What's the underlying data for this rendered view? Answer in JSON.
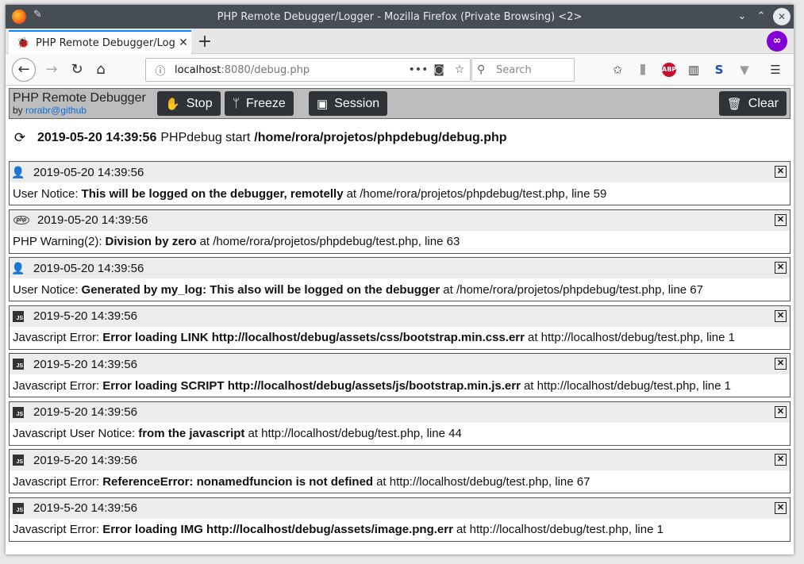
{
  "browser": {
    "window_title": "PHP Remote Debugger/Logger - Mozilla Firefox (Private Browsing) <2>",
    "tab_title": "PHP Remote Debugger/Logger",
    "url_host": "localhost",
    "url_rest": ":8080/debug.php",
    "search_placeholder": "Search"
  },
  "app": {
    "brand_title": "PHP Remote Debugger",
    "brand_by": "by",
    "brand_link": "rorabr@github",
    "buttons": {
      "stop": "Stop",
      "freeze": "Freeze",
      "session": "Session",
      "clear": "Clear"
    }
  },
  "start": {
    "timestamp": "2019-05-20 14:39:56",
    "text": "PHPdebug start",
    "path": "/home/rora/projetos/phpdebug/debug.php"
  },
  "entries": [
    {
      "icon": "user-icon",
      "time": "2019-05-20 14:39:56",
      "type": "User Notice:",
      "message": "This will be logged on the debugger, remotelly",
      "location": "at /home/rora/projetos/phpdebug/test.php, line 59"
    },
    {
      "icon": "php-icon",
      "time": "2019-05-20 14:39:56",
      "type": "PHP Warning(2):",
      "message": "Division by zero",
      "location": "at /home/rora/projetos/phpdebug/test.php, line 63"
    },
    {
      "icon": "user-icon",
      "time": "2019-05-20 14:39:56",
      "type": "User Notice:",
      "message": "Generated by my_log: This also will be logged on the debugger",
      "location": "at /home/rora/projetos/phpdebug/test.php, line 67"
    },
    {
      "icon": "js-icon",
      "time": "2019-5-20 14:39:56",
      "type": "Javascript Error:",
      "message": "Error loading LINK http://localhost/debug/assets/css/bootstrap.min.css.err",
      "location": "at http://localhost/debug/test.php, line 1"
    },
    {
      "icon": "js-icon",
      "time": "2019-5-20 14:39:56",
      "type": "Javascript Error:",
      "message": "Error loading SCRIPT http://localhost/debug/assets/js/bootstrap.min.js.err",
      "location": "at http://localhost/debug/test.php, line 1"
    },
    {
      "icon": "js-icon",
      "time": "2019-5-20 14:39:56",
      "type": "Javascript User Notice:",
      "message": "from the javascript",
      "location": "at http://localhost/debug/test.php, line 44"
    },
    {
      "icon": "js-icon",
      "time": "2019-5-20 14:39:56",
      "type": "Javascript Error:",
      "message": "ReferenceError: nonamedfuncion is not defined",
      "location": "at http://localhost/debug/test.php, line 67"
    },
    {
      "icon": "js-icon",
      "time": "2019-5-20 14:39:56",
      "type": "Javascript Error:",
      "message": "Error loading IMG http://localhost/debug/assets/image.png.err",
      "location": "at http://localhost/debug/test.php, line 1"
    }
  ]
}
